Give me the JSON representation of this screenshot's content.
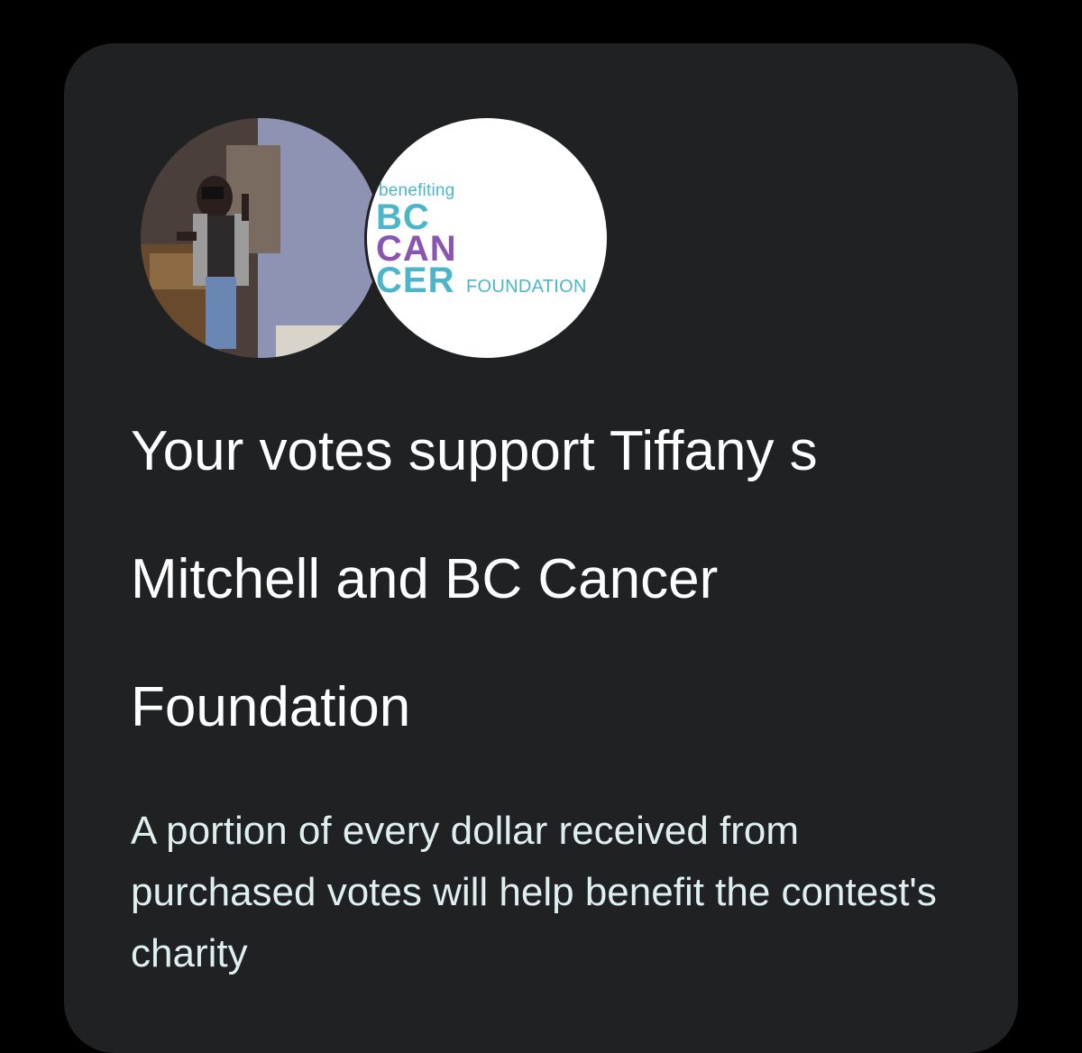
{
  "avatars": {
    "person_icon": "contestant-photo",
    "charity_logo": {
      "small_text": "benefiting",
      "line1": "BC",
      "line2": "CAN",
      "line3": "CER",
      "foundation_text": "FOUNDATION",
      "colors": {
        "teal": "#4bb6c9",
        "purple": "#8a55b0"
      }
    }
  },
  "headline": "Your votes support Tiffany s Mitchell and BC Cancer Foundation",
  "description": "A portion of every dollar received from purchased votes will help benefit the contest's charity",
  "colors": {
    "page_background": "#000000",
    "card_background": "#1f2123",
    "headline_text": "#ffffff",
    "body_text": "#dfeff0"
  }
}
